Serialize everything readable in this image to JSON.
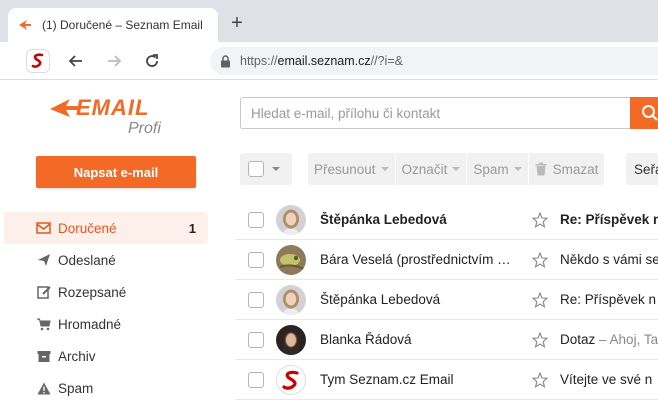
{
  "browser": {
    "tab_title": "(1) Doručené – Seznam Email",
    "new_tab_label": "+",
    "url_prefix": "https://",
    "url_host": "email.seznam.cz",
    "url_rest": "//?i=&"
  },
  "logo": {
    "main": "EMAIL",
    "sub": "Profi"
  },
  "compose_label": "Napsat e-mail",
  "folders": [
    {
      "label": "Doručené",
      "count": "1",
      "icon": "inbox-icon",
      "active": true
    },
    {
      "label": "Odeslané",
      "icon": "sent-icon"
    },
    {
      "label": "Rozepsané",
      "icon": "drafts-icon"
    },
    {
      "label": "Hromadné",
      "icon": "cart-icon"
    },
    {
      "label": "Archiv",
      "icon": "archive-icon"
    },
    {
      "label": "Spam",
      "icon": "spam-warning-icon"
    }
  ],
  "search": {
    "placeholder": "Hledat e-mail, přílohu či kontakt"
  },
  "toolbar": {
    "move": "Přesunout",
    "mark": "Označit",
    "spam": "Spam",
    "delete": "Smazat",
    "sort": "Seřa"
  },
  "mails": [
    {
      "sender": "Štěpánka Lebedová",
      "subject": "Re: Příspěvek n",
      "preview": "",
      "unread": true,
      "avatar": "woman-blonde"
    },
    {
      "sender": "Bára Veselá (prostřednictvím …",
      "subject": "Někdo s vámi se",
      "preview": "",
      "unread": false,
      "avatar": "chameleon"
    },
    {
      "sender": "Štěpánka Lebedová",
      "subject": "Re: Příspěvek n",
      "preview": "",
      "unread": false,
      "avatar": "woman-blonde"
    },
    {
      "sender": "Blanka Řádová",
      "subject": "Dotaz",
      "preview": " – Ahoj, Ta",
      "unread": false,
      "avatar": "woman-dark"
    },
    {
      "sender": "Tym Seznam.cz Email",
      "subject": "Vítejte ve své n",
      "preview": "",
      "unread": false,
      "avatar": "seznam-logo"
    }
  ],
  "colors": {
    "accent": "#f26a25",
    "active_bg": "#fdf0ea",
    "active_text": "#e9541f"
  }
}
